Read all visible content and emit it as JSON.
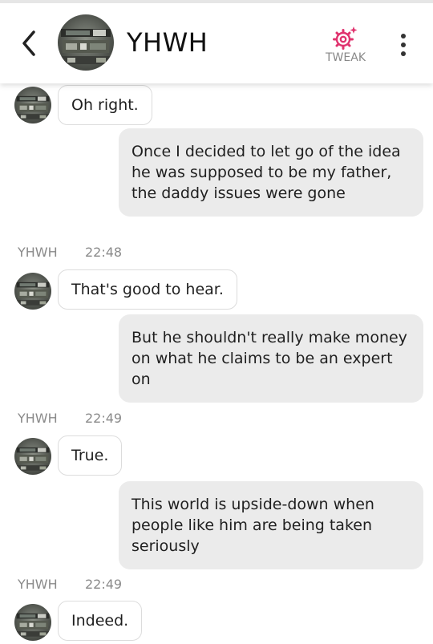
{
  "header": {
    "title": "YHWH",
    "tweak_label": "TWEAK",
    "back_icon": "chevron-left-icon",
    "menu_icon": "more-vert-icon",
    "accent_color": "#e0336e"
  },
  "messages": [
    {
      "type": "received",
      "text": "Oh right."
    },
    {
      "type": "sent",
      "text": "Once I decided to let go of the idea he was supposed to be my father, the daddy issues were gone"
    },
    {
      "type": "meta",
      "name": "YHWH",
      "time": "22:48"
    },
    {
      "type": "received",
      "text": "That's good to hear."
    },
    {
      "type": "sent",
      "text": "But he shouldn't really make money on what he claims to be an expert on"
    },
    {
      "type": "meta",
      "name": "YHWH",
      "time": "22:49"
    },
    {
      "type": "received",
      "text": "True."
    },
    {
      "type": "sent",
      "text": "This world is upside-down when people like him are being taken seriously"
    },
    {
      "type": "meta",
      "name": "YHWH",
      "time": "22:49"
    },
    {
      "type": "received",
      "text": "Indeed."
    }
  ]
}
